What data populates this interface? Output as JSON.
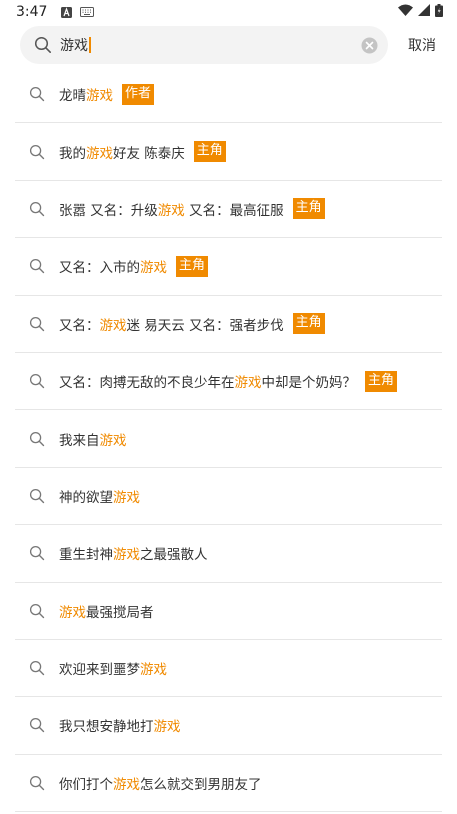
{
  "status_bar": {
    "time": "3:47"
  },
  "search": {
    "query": "游戏",
    "cancel_label": "取消"
  },
  "results": [
    {
      "segments": [
        {
          "t": "龙晴",
          "h": false
        },
        {
          "t": "游戏",
          "h": true
        }
      ],
      "tag": "作者"
    },
    {
      "segments": [
        {
          "t": "我的",
          "h": false
        },
        {
          "t": "游戏",
          "h": true
        },
        {
          "t": "好友 陈泰庆",
          "h": false
        }
      ],
      "tag": "主角"
    },
    {
      "segments": [
        {
          "t": "张嚣  又名：升级",
          "h": false
        },
        {
          "t": "游戏",
          "h": true
        },
        {
          "t": "  又名：最高征服",
          "h": false
        }
      ],
      "tag": "主角"
    },
    {
      "segments": [
        {
          "t": "又名：入市的",
          "h": false
        },
        {
          "t": "游戏",
          "h": true
        }
      ],
      "tag": "主角"
    },
    {
      "segments": [
        {
          "t": "又名：",
          "h": false
        },
        {
          "t": "游戏",
          "h": true
        },
        {
          "t": "迷 易天云  又名：强者步伐",
          "h": false
        }
      ],
      "tag": "主角"
    },
    {
      "segments": [
        {
          "t": "又名：肉搏无敌的不良少年在",
          "h": false
        },
        {
          "t": "游戏",
          "h": true
        },
        {
          "t": "中却是个奶妈？",
          "h": false
        }
      ],
      "tag": "主角"
    },
    {
      "segments": [
        {
          "t": "我来自",
          "h": false
        },
        {
          "t": "游戏",
          "h": true
        }
      ],
      "tag": ""
    },
    {
      "segments": [
        {
          "t": "神的欲望",
          "h": false
        },
        {
          "t": "游戏",
          "h": true
        }
      ],
      "tag": ""
    },
    {
      "segments": [
        {
          "t": "重生封神",
          "h": false
        },
        {
          "t": "游戏",
          "h": true
        },
        {
          "t": "之最强散人",
          "h": false
        }
      ],
      "tag": ""
    },
    {
      "segments": [
        {
          "t": "游戏",
          "h": true
        },
        {
          "t": "最强搅局者",
          "h": false
        }
      ],
      "tag": ""
    },
    {
      "segments": [
        {
          "t": "欢迎来到噩梦",
          "h": false
        },
        {
          "t": "游戏",
          "h": true
        }
      ],
      "tag": ""
    },
    {
      "segments": [
        {
          "t": "我只想安静地打",
          "h": false
        },
        {
          "t": "游戏",
          "h": true
        }
      ],
      "tag": ""
    },
    {
      "segments": [
        {
          "t": "你们打个",
          "h": false
        },
        {
          "t": "游戏",
          "h": true
        },
        {
          "t": "怎么就交到男朋友了",
          "h": false
        }
      ],
      "tag": ""
    }
  ],
  "colors": {
    "accent": "#f08a00",
    "divider": "#e6e6e6",
    "search_bg": "#f3f3f3"
  }
}
